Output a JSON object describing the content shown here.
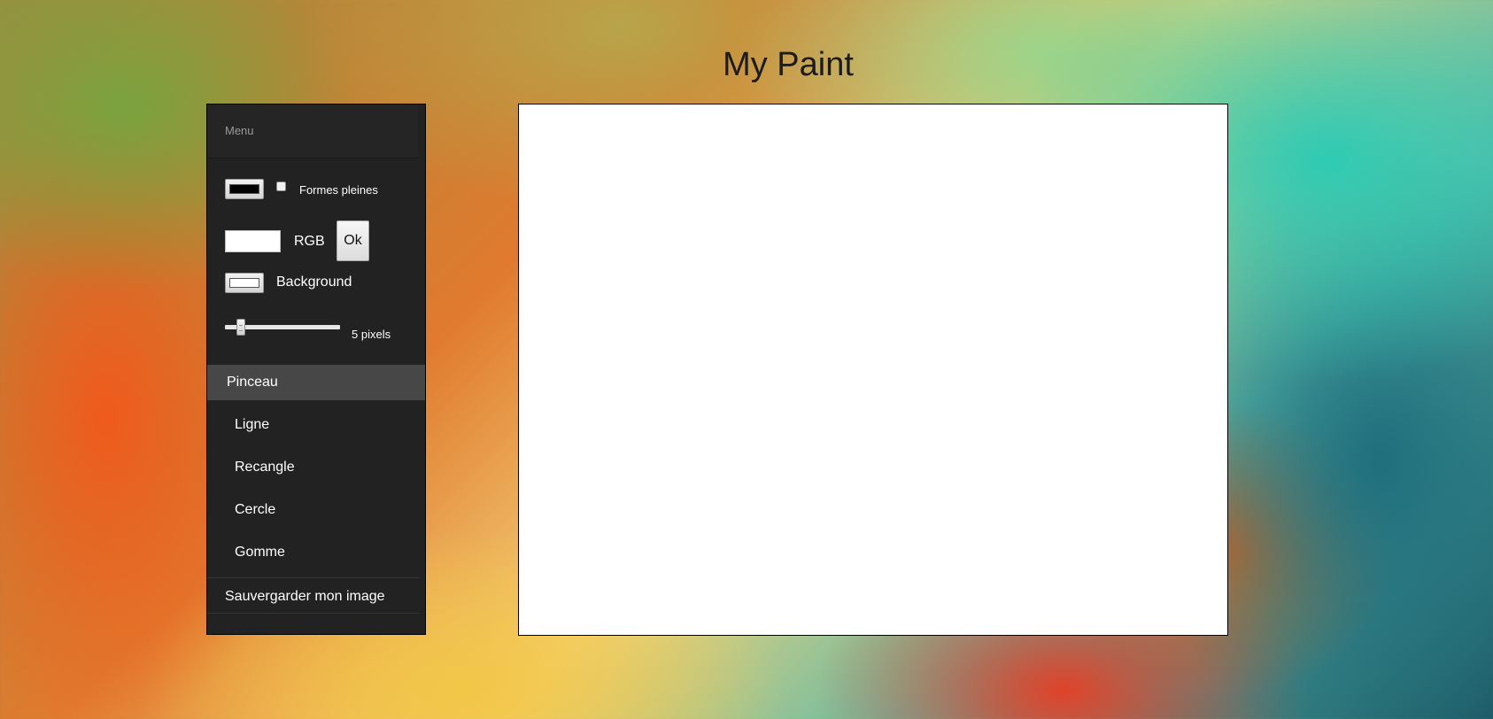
{
  "app": {
    "title": "My Paint"
  },
  "menu": {
    "header": "Menu",
    "stroke_color_icon": "color-picker-icon",
    "stroke_color": "#000000",
    "filled_shapes_label": "Formes pleines",
    "filled_shapes_checked": false,
    "rgb_input_value": "",
    "rgb_label": "RGB",
    "ok_label": "Ok",
    "background_color": "#ffffff",
    "background_label": "Background",
    "size_value": 5,
    "size_min": 1,
    "size_max": 50,
    "size_label": "5 pixels",
    "tools": [
      {
        "label": "Pinceau",
        "active": true
      },
      {
        "label": "Ligne",
        "active": false
      },
      {
        "label": "Recangle",
        "active": false
      },
      {
        "label": "Cercle",
        "active": false
      },
      {
        "label": "Gomme",
        "active": false
      }
    ],
    "save_label": "Sauvergarder mon image"
  },
  "colors": {
    "menu_background": "#222222",
    "active_tool": "#474747",
    "canvas": "#ffffff"
  }
}
